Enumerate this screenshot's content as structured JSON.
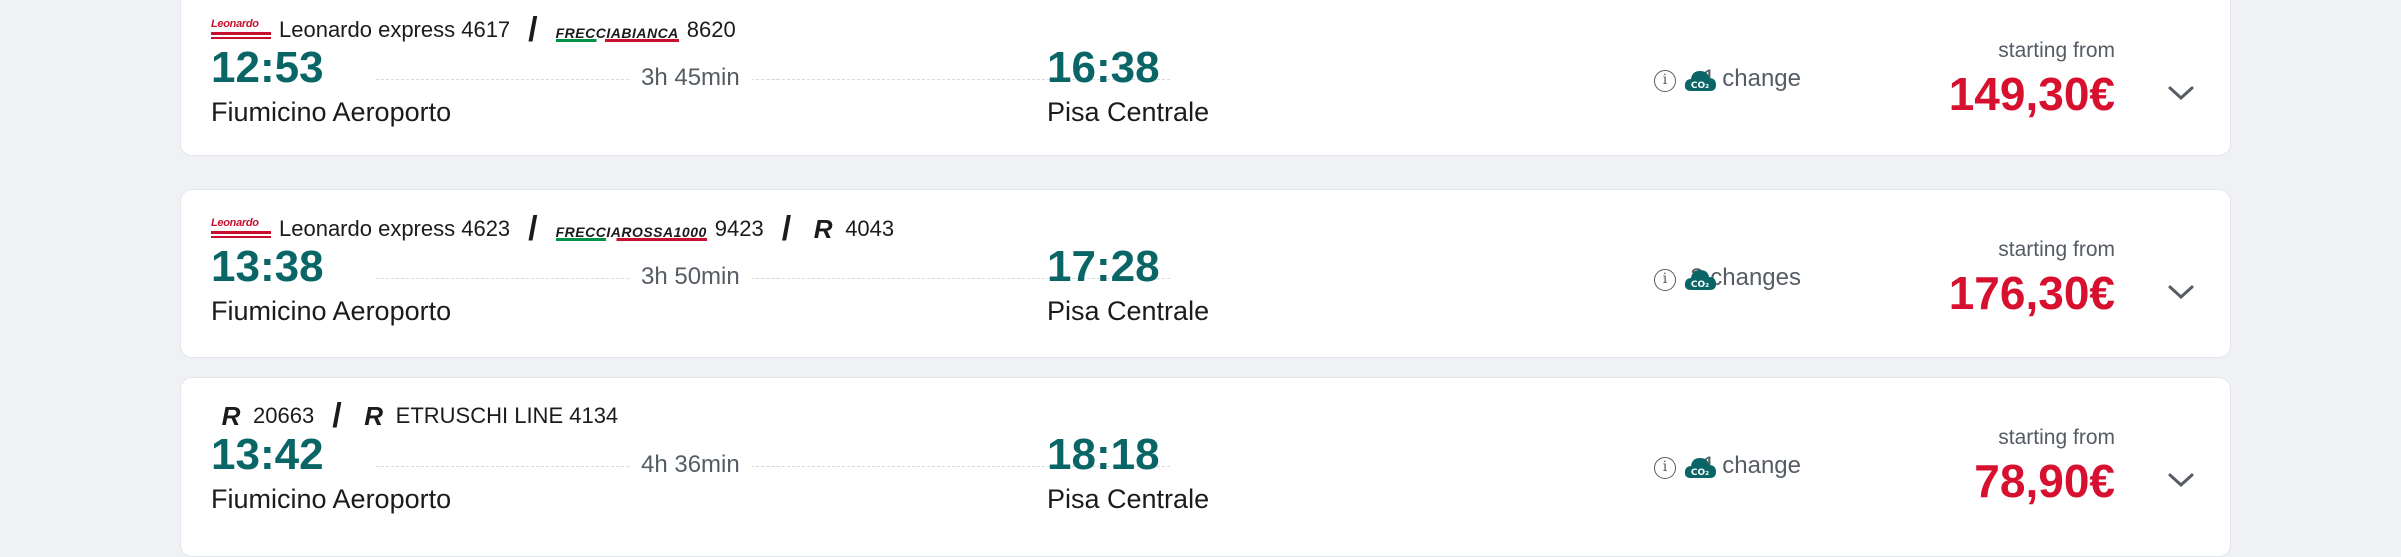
{
  "results": [
    {
      "trains": [
        {
          "logo": "leonardo",
          "logo_text": "Leonardo",
          "label": "Leonardo express 4617"
        },
        {
          "logo": "frecciabianca",
          "logo_text": "FRECCIABIANCA",
          "label": "8620"
        }
      ],
      "departure_time": "12:53",
      "departure_station": "Fiumicino Aeroporto",
      "duration": "3h 45min",
      "arrival_time": "16:38",
      "arrival_station": "Pisa Centrale",
      "changes": "1 change",
      "from_label": "starting from",
      "price": "149,30€"
    },
    {
      "trains": [
        {
          "logo": "leonardo",
          "logo_text": "Leonardo",
          "label": "Leonardo express 4623"
        },
        {
          "logo": "frecciarossa",
          "logo_text": "FRECCIAROSSA1000",
          "label": "9423"
        },
        {
          "logo": "regionale",
          "logo_text": "R",
          "label": "4043"
        }
      ],
      "departure_time": "13:38",
      "departure_station": "Fiumicino Aeroporto",
      "duration": "3h 50min",
      "arrival_time": "17:28",
      "arrival_station": "Pisa Centrale",
      "changes": "2 changes",
      "from_label": "starting from",
      "price": "176,30€"
    },
    {
      "trains": [
        {
          "logo": "regionale",
          "logo_text": "R",
          "label": "20663"
        },
        {
          "logo": "regionale",
          "logo_text": "R",
          "label": "ETRUSCHI LINE 4134"
        }
      ],
      "departure_time": "13:42",
      "departure_station": "Fiumicino Aeroporto",
      "duration": "4h 36min",
      "arrival_time": "18:18",
      "arrival_station": "Pisa Centrale",
      "changes": "1 change",
      "from_label": "starting from",
      "price": "78,90€"
    }
  ],
  "icons": {
    "info": "info-icon",
    "co2": "co2-cloud-icon",
    "expand": "chevron-down-icon"
  },
  "colors": {
    "time": "#0a6666",
    "price": "#d8102f",
    "background": "#eff1f4"
  }
}
